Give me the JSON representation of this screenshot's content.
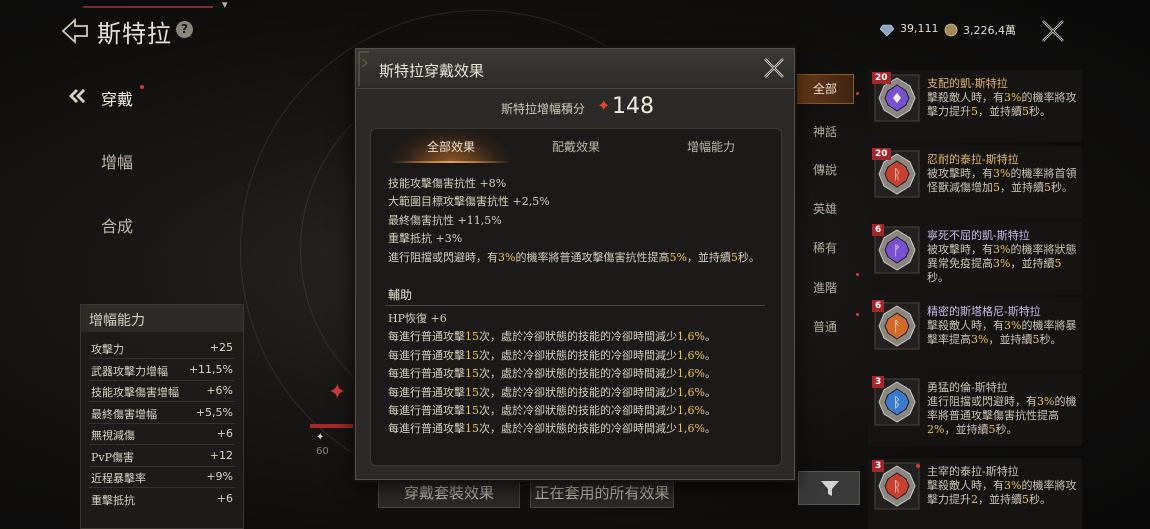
{
  "header": {
    "title": "斯特拉",
    "help": "?"
  },
  "nav": {
    "items": [
      {
        "label": "穿戴",
        "active": true
      },
      {
        "label": "增幅",
        "active": false
      },
      {
        "label": "合成",
        "active": false
      }
    ]
  },
  "stats": {
    "heading": "增幅能力",
    "rows": [
      {
        "label": "攻擊力",
        "value": "+25"
      },
      {
        "label": "武器攻擊力增幅",
        "value": "+11,5%"
      },
      {
        "label": "技能攻擊傷害增幅",
        "value": "+6%"
      },
      {
        "label": "最終傷害增幅",
        "value": "+5,5%"
      },
      {
        "label": "無視減傷",
        "value": "+6"
      },
      {
        "label": "PvP傷害",
        "value": "+12"
      },
      {
        "label": "近程暴擊率",
        "value": "+9%"
      },
      {
        "label": "重擊抵抗",
        "value": "+6"
      }
    ]
  },
  "center": {
    "progress_label": "60",
    "equip_set_button": "穿戴套裝效果",
    "all_effects_button": "正在套用的所有效果"
  },
  "currency": {
    "diamond": "39,111",
    "gold": "3,226,4萬"
  },
  "categories": [
    {
      "label": "全部",
      "active": true
    },
    {
      "label": "神話"
    },
    {
      "label": "傳說"
    },
    {
      "label": "英雄"
    },
    {
      "label": "稀有"
    },
    {
      "label": "進階"
    },
    {
      "label": "普通"
    }
  ],
  "items": [
    {
      "level": "20",
      "name": "支配的凱-斯特拉",
      "name_color": "#e8b86a",
      "gem_color": "#7a4fd1",
      "rune": "♦",
      "desc": [
        {
          "t": "擊殺敵人時，有"
        },
        {
          "t": "3%",
          "h": true
        },
        {
          "t": "的機率將攻擊力提升"
        },
        {
          "t": "5",
          "h": true
        },
        {
          "t": "，並持續"
        },
        {
          "t": "5",
          "h": true
        },
        {
          "t": "秒。"
        }
      ]
    },
    {
      "level": "20",
      "name": "忍耐的泰拉-斯特拉",
      "name_color": "#e8b86a",
      "gem_color": "#c9402e",
      "rune": "ᚱ",
      "desc": [
        {
          "t": "被攻擊時，有"
        },
        {
          "t": "3%",
          "h": true
        },
        {
          "t": "的機率將首領怪獸減傷增加"
        },
        {
          "t": "5",
          "h": true
        },
        {
          "t": "，並持續"
        },
        {
          "t": "5",
          "h": true
        },
        {
          "t": "秒。"
        }
      ]
    },
    {
      "level": "6",
      "name": "寧死不屈的凱-斯特拉",
      "name_color": "#c8b7e6",
      "gem_color": "#7a4fd1",
      "rune": "ᚠ",
      "desc": [
        {
          "t": "被攻擊時，有"
        },
        {
          "t": "3%",
          "h": true
        },
        {
          "t": "的機率將狀態異常免疫提高"
        },
        {
          "t": "3%",
          "h": true
        },
        {
          "t": "，並持續"
        },
        {
          "t": "5",
          "h": true
        },
        {
          "t": "秒。"
        }
      ]
    },
    {
      "level": "6",
      "name": "精密的斯塔格尼-斯特拉",
      "name_color": "#c8b7e6",
      "gem_color": "#d26a2a",
      "rune": "ᚨ",
      "desc": [
        {
          "t": "擊殺敵人時，有"
        },
        {
          "t": "3%",
          "h": true
        },
        {
          "t": "的機率將暴擊率提高"
        },
        {
          "t": "3%",
          "h": true
        },
        {
          "t": "，並持續"
        },
        {
          "t": "5",
          "h": true
        },
        {
          "t": "秒。"
        }
      ]
    },
    {
      "level": "3",
      "name": "勇猛的倫-斯特拉",
      "name_color": "#c9c2b3",
      "gem_color": "#3a7bd1",
      "rune": "ᛒ",
      "desc": [
        {
          "t": "進行阻擋或閃避時，有"
        },
        {
          "t": "3%",
          "h": true
        },
        {
          "t": "的機率將普通攻擊傷害抗性提高"
        },
        {
          "t": "2%",
          "h": true
        },
        {
          "t": "，並持續"
        },
        {
          "t": "5",
          "h": true
        },
        {
          "t": "秒。"
        }
      ]
    },
    {
      "level": "3",
      "name": "主宰的泰拉-斯特拉",
      "name_color": "#c9c2b3",
      "gem_color": "#c9402e",
      "rune": "ᚱ",
      "desc": [
        {
          "t": "擊殺敵人時，有"
        },
        {
          "t": "3%",
          "h": true
        },
        {
          "t": "的機率將攻擊力提升"
        },
        {
          "t": "2",
          "h": true
        },
        {
          "t": "，並持續"
        },
        {
          "t": "5",
          "h": true
        },
        {
          "t": "秒。"
        }
      ]
    }
  ],
  "modal": {
    "title": "斯特拉穿戴效果",
    "score_label": "斯特拉增幅積分",
    "score_value": "148",
    "tabs": [
      {
        "label": "全部效果",
        "active": true
      },
      {
        "label": "配戴效果"
      },
      {
        "label": "增幅能力"
      }
    ],
    "effects": [
      [
        {
          "t": "技能攻擊傷害抗性 +8%"
        }
      ],
      [
        {
          "t": "大範圍目標攻擊傷害抗性 +2,5%"
        }
      ],
      [
        {
          "t": "最終傷害抗性 +11,5%"
        }
      ],
      [
        {
          "t": "重擊抵抗 +3%"
        }
      ],
      [
        {
          "t": "進行阻擋或閃避時，有"
        },
        {
          "t": "3%",
          "h": true
        },
        {
          "t": "的機率將普通攻擊傷害抗性提高"
        },
        {
          "t": "5%",
          "h": true
        },
        {
          "t": "，並持續"
        },
        {
          "t": "5",
          "h": true
        },
        {
          "t": "秒。"
        }
      ]
    ],
    "support_heading": "輔助",
    "support": [
      [
        {
          "t": "HP恢復 +6"
        }
      ],
      [
        {
          "t": "每進行普通攻擊"
        },
        {
          "t": "15",
          "h": true
        },
        {
          "t": "次，處於冷卻狀態的技能的冷卻時間減少"
        },
        {
          "t": "1,6%",
          "h": true
        },
        {
          "t": "。"
        }
      ],
      [
        {
          "t": "每進行普通攻擊"
        },
        {
          "t": "15",
          "h": true
        },
        {
          "t": "次，處於冷卻狀態的技能的冷卻時間減少"
        },
        {
          "t": "1,6%",
          "h": true
        },
        {
          "t": "。"
        }
      ],
      [
        {
          "t": "每進行普通攻擊"
        },
        {
          "t": "15",
          "h": true
        },
        {
          "t": "次，處於冷卻狀態的技能的冷卻時間減少"
        },
        {
          "t": "1,6%",
          "h": true
        },
        {
          "t": "。"
        }
      ],
      [
        {
          "t": "每進行普通攻擊"
        },
        {
          "t": "15",
          "h": true
        },
        {
          "t": "次，處於冷卻狀態的技能的冷卻時間減少"
        },
        {
          "t": "1,6%",
          "h": true
        },
        {
          "t": "。"
        }
      ],
      [
        {
          "t": "每進行普通攻擊"
        },
        {
          "t": "15",
          "h": true
        },
        {
          "t": "次，處於冷卻狀態的技能的冷卻時間減少"
        },
        {
          "t": "1,6%",
          "h": true
        },
        {
          "t": "。"
        }
      ],
      [
        {
          "t": "每進行普通攻擊"
        },
        {
          "t": "15",
          "h": true
        },
        {
          "t": "次，處於冷卻狀態的技能的冷卻時間減少"
        },
        {
          "t": "1,6%",
          "h": true
        },
        {
          "t": "。"
        }
      ]
    ]
  }
}
